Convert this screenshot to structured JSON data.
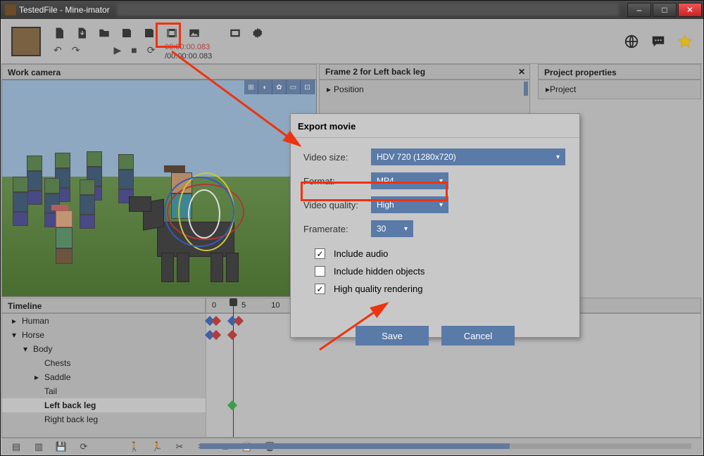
{
  "window": {
    "title": "TestedFile - Mine-imator",
    "buttons": {
      "min": "–",
      "max": "□",
      "close": "✕"
    }
  },
  "toolbar": {
    "time_current": "00:00:00.083",
    "time_total": "/00:00:00.083"
  },
  "panel_workcam": {
    "title": "Work camera"
  },
  "panel_frame": {
    "title": "Frame 2 for Left back leg",
    "close": "✕",
    "position_label": "Position"
  },
  "panel_props": {
    "title": "Project properties",
    "project_label": "Project"
  },
  "dialog": {
    "title": "Export movie",
    "video_size_label": "Video size:",
    "video_size_value": "HDV 720 (1280x720)",
    "format_label": "Format:",
    "format_value": "MP4",
    "quality_label": "Video quality:",
    "quality_value": "High",
    "framerate_label": "Framerate:",
    "framerate_value": "30",
    "chk_audio": "Include audio",
    "chk_hidden": "Include hidden objects",
    "chk_hq": "High quality rendering",
    "save": "Save",
    "cancel": "Cancel",
    "chk_audio_checked": true,
    "chk_hidden_checked": false,
    "chk_hq_checked": true
  },
  "timeline": {
    "title": "Timeline",
    "ruler": [
      "0",
      "5",
      "10"
    ],
    "tree": [
      {
        "label": "Human",
        "depth": 0,
        "caret": "▸"
      },
      {
        "label": "Horse",
        "depth": 0,
        "caret": "▾"
      },
      {
        "label": "Body",
        "depth": 1,
        "caret": "▾"
      },
      {
        "label": "Chests",
        "depth": 2,
        "caret": ""
      },
      {
        "label": "Saddle",
        "depth": 2,
        "caret": "▸"
      },
      {
        "label": "Tail",
        "depth": 2,
        "caret": ""
      },
      {
        "label": "Left back leg",
        "depth": 2,
        "caret": "",
        "sel": true
      },
      {
        "label": "Right back leg",
        "depth": 2,
        "caret": ""
      }
    ]
  }
}
